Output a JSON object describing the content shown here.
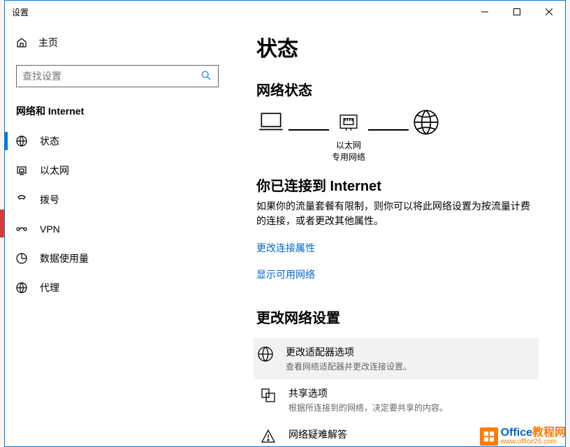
{
  "window": {
    "title": "设置"
  },
  "sidebar": {
    "home": "主页",
    "search_placeholder": "查找设置",
    "section": "网络和 Internet",
    "items": [
      {
        "label": "状态",
        "active": true
      },
      {
        "label": "以太网",
        "active": false
      },
      {
        "label": "拨号",
        "active": false
      },
      {
        "label": "VPN",
        "active": false
      },
      {
        "label": "数据使用量",
        "active": false
      },
      {
        "label": "代理",
        "active": false
      }
    ]
  },
  "main": {
    "title": "状态",
    "network_status_heading": "网络状态",
    "diagram": {
      "ethernet_label": "以太网",
      "private_network_label": "专用网络"
    },
    "connected_title": "你已连接到 Internet",
    "connected_desc": "如果你的流量套餐有限制，则你可以将此网络设置为按流量计费的连接，或者更改其他属性。",
    "link_change_props": "更改连接属性",
    "link_show_networks": "显示可用网络",
    "change_settings_heading": "更改网络设置",
    "options": [
      {
        "title": "更改适配器选项",
        "desc": "查看网络适配器并更改连接设置。"
      },
      {
        "title": "共享选项",
        "desc": "根据所连接到的网络，决定要共享的内容。"
      },
      {
        "title": "网络疑难解答",
        "desc": ""
      }
    ]
  },
  "watermark": {
    "brand_prefix": "Office",
    "brand_suffix": "教程网",
    "url": "www.office26.com"
  }
}
